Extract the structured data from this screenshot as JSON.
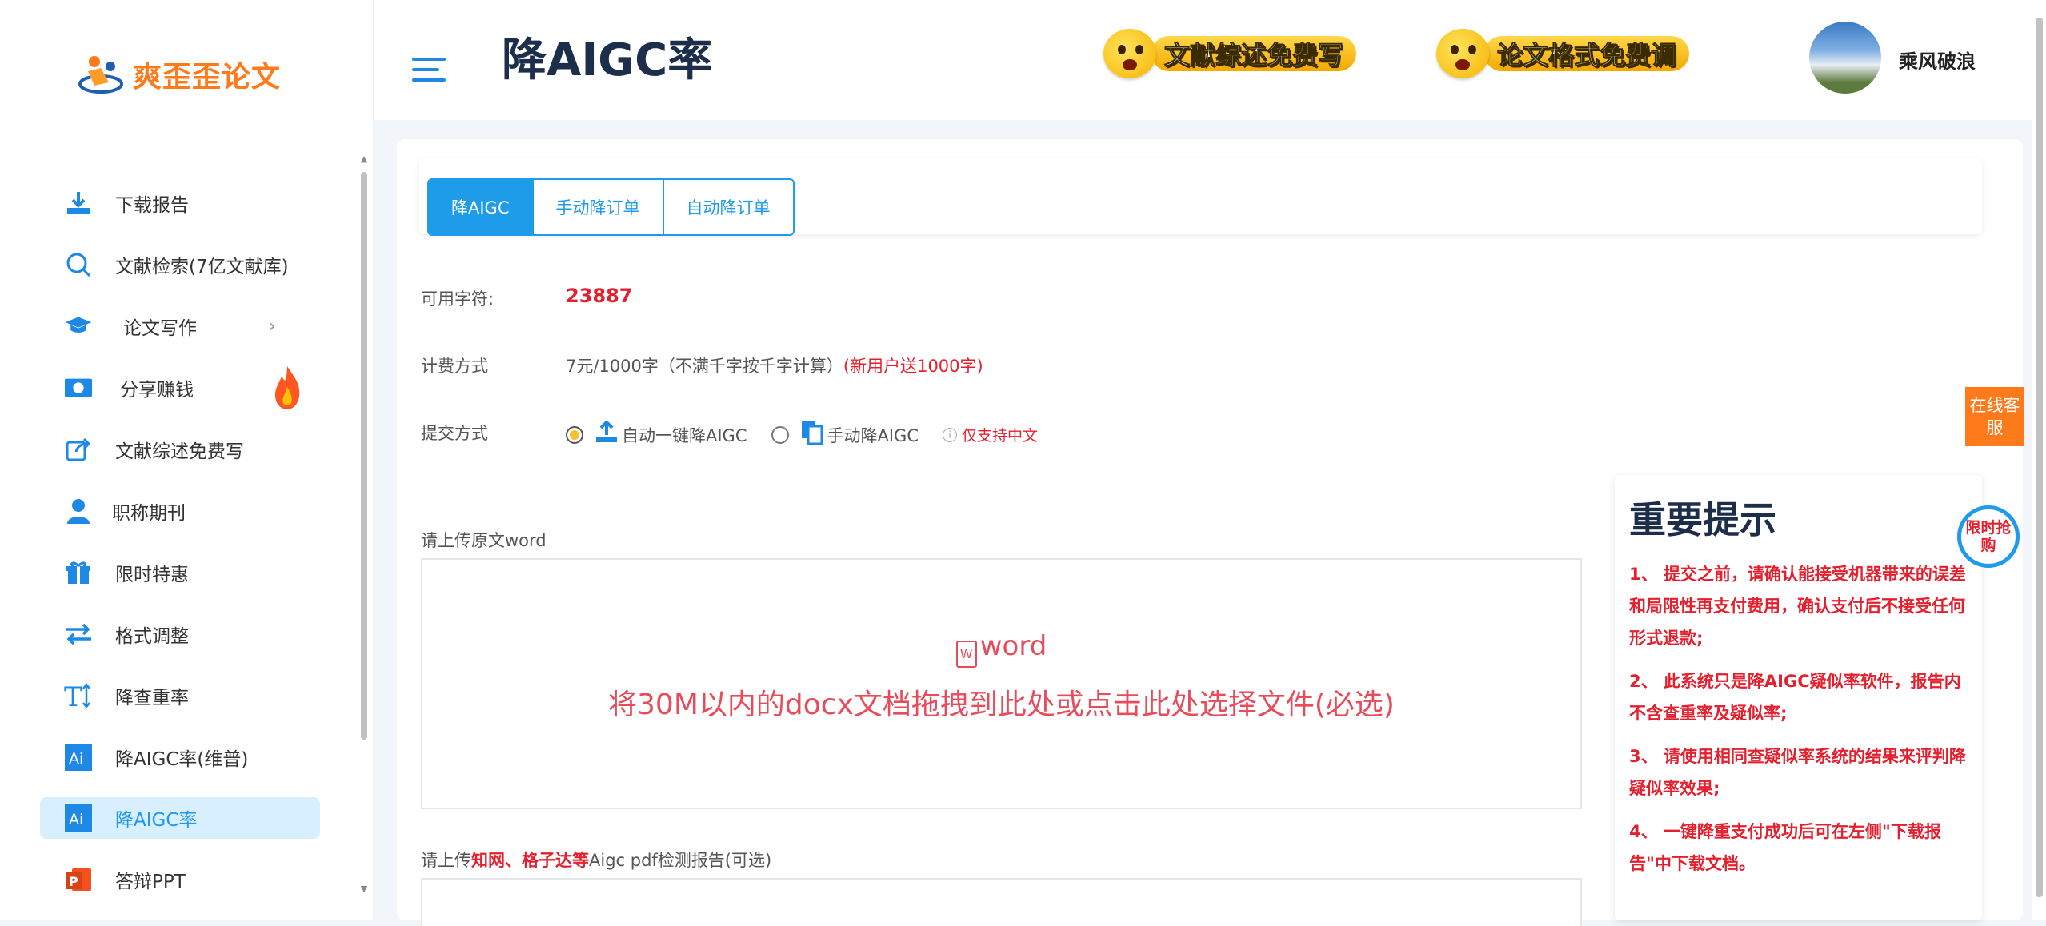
{
  "brand": {
    "name": "爽歪歪论文"
  },
  "header": {
    "title": "降AIGC率",
    "promo1": "文献综述免费写",
    "promo2": "论文格式免费调",
    "username": "乘风破浪"
  },
  "sidebar": {
    "items": [
      {
        "label": "下载报告",
        "icon": "download-icon"
      },
      {
        "label": "文献检索(7亿文献库)",
        "icon": "search-icon"
      },
      {
        "label": "论文写作",
        "icon": "graduation-cap-icon"
      },
      {
        "label": "分享赚钱",
        "icon": "money-icon"
      },
      {
        "label": "文献综述免费写",
        "icon": "share-icon"
      },
      {
        "label": "职称期刊",
        "icon": "user-icon"
      },
      {
        "label": "限时特惠",
        "icon": "gift-icon"
      },
      {
        "label": "格式调整",
        "icon": "swap-icon"
      },
      {
        "label": "降查重率",
        "icon": "text-height-icon"
      },
      {
        "label": "降AIGC率(维普)",
        "icon": "ai-icon"
      },
      {
        "label": "降AIGC率",
        "icon": "ai-icon"
      },
      {
        "label": "答辩PPT",
        "icon": "powerpoint-icon"
      }
    ]
  },
  "tabs": [
    "降AIGC",
    "手动降订单",
    "自动降订单"
  ],
  "form": {
    "chars_label": "可用字符:",
    "chars_value": "23887",
    "billing_label": "计费方式",
    "billing_value": "7元/1000字（不满千字按千字计算）",
    "billing_promo": "(新用户送1000字)",
    "submit_label": "提交方式",
    "opt_auto": "自动一键降AIGC",
    "opt_manual": "手动降AIGC",
    "only_chinese": "仅支持中文",
    "upload1_label": "请上传原文word",
    "dz_word": "word",
    "dz_text": "将30M以内的docx文档拖拽到此处或点击此处选择文件(必选)",
    "upload2_pre": "请上传",
    "upload2_red": "知网、格子达等",
    "upload2_post": "Aigc pdf检测报告(可选)"
  },
  "tip": {
    "title": "重要提示",
    "items": [
      "1、 提交之前，请确认能接受机器带来的误差和局限性再支付费用，确认支付后不接受任何形式退款;",
      "2、 此系统只是降AIGC疑似率软件，报告内不含查重率及疑似率;",
      "3、 请使用相同查疑似率系统的结果来评判降疑似率效果;",
      "4、 一键降重支付成功后可在左侧\"下载报告\"中下载文档。"
    ]
  },
  "float": {
    "service": "在线客服",
    "badge": "限时抢购"
  }
}
